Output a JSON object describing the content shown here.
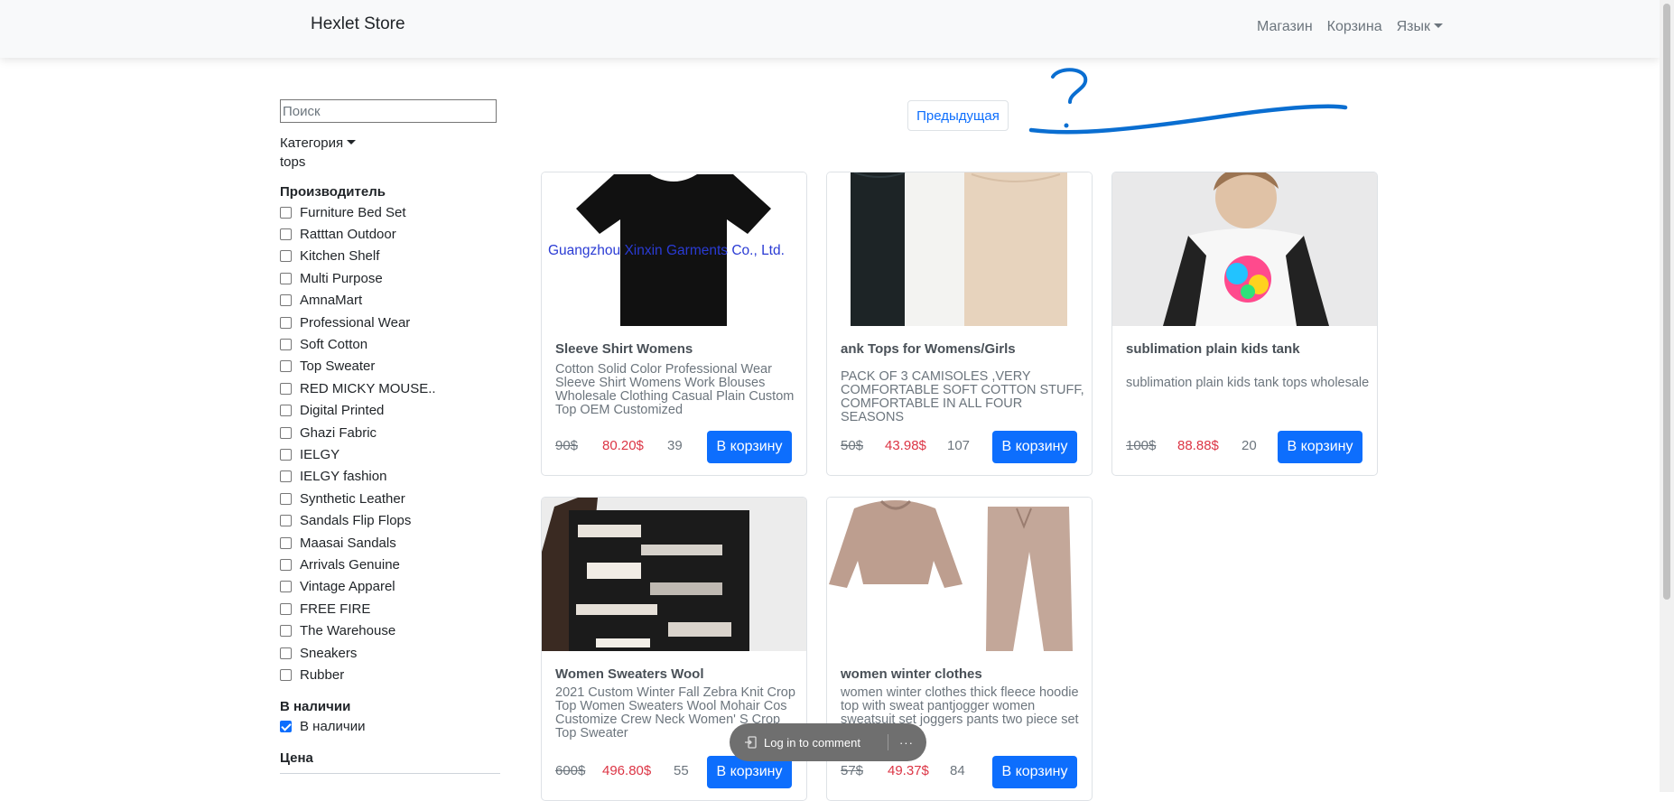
{
  "navbar": {
    "brand": "Hexlet Store",
    "links": [
      "Магазин",
      "Корзина"
    ],
    "language": "Язык"
  },
  "sidebar": {
    "search_placeholder": "Поиск",
    "category_label": "Категория",
    "category_value": "tops",
    "manufacturer_title": "Производитель",
    "manufacturers": [
      "Furniture Bed Set",
      "Ratttan Outdoor",
      "Kitchen Shelf",
      "Multi Purpose",
      "AmnaMart",
      "Professional Wear",
      "Soft Cotton",
      "Top Sweater",
      "RED MICKY MOUSE..",
      "Digital Printed",
      "Ghazi Fabric",
      "IELGY",
      "IELGY fashion",
      "Synthetic Leather",
      "Sandals Flip Flops",
      "Maasai Sandals",
      "Arrivals Genuine",
      "Vintage Apparel",
      "FREE FIRE",
      "The Warehouse",
      "Sneakers",
      "Rubber"
    ],
    "stock_title": "В наличии",
    "stock_option": "В наличии",
    "price_title": "Цена"
  },
  "pagination": {
    "prev": "Предыдущая"
  },
  "products": [
    {
      "title": "Sleeve Shirt Womens",
      "description": "Cotton Solid Color Professional Wear Sleeve Shirt Womens Work Blouses Wholesale Clothing Casual Plain Custom Top OEM Customized",
      "old_price": "90$",
      "price": "80.20$",
      "qty": "39",
      "button": "В корзину",
      "watermark": "Guangzhou Xinxin Garments Co., Ltd."
    },
    {
      "title": "ank Tops for Womens/Girls",
      "description": "PACK OF 3 CAMISOLES ,VERY COMFORTABLE SOFT COTTON STUFF, COMFORTABLE IN ALL FOUR SEASONS",
      "old_price": "50$",
      "price": "43.98$",
      "qty": "107",
      "button": "В корзину"
    },
    {
      "title": "sublimation plain kids tank",
      "description": "sublimation plain kids tank tops wholesale",
      "old_price": "100$",
      "price": "88.88$",
      "qty": "20",
      "button": "В корзину"
    },
    {
      "title": "Women Sweaters Wool",
      "description": "2021 Custom Winter Fall Zebra Knit Crop Top Women Sweaters Wool Mohair Cos Customize Crew Neck Women' S Crop Top Sweater",
      "old_price": "600$",
      "price": "496.80$",
      "qty": "55",
      "button": "В корзину"
    },
    {
      "title": "women winter clothes",
      "description": "women winter clothes thick fleece hoodie top with sweat pantjogger women sweatsuit set joggers pants two piece set",
      "old_price": "57$",
      "price": "49.37$",
      "qty": "84",
      "button": "В корзину"
    }
  ],
  "comment_bar": {
    "label": "Log in to comment",
    "more": "···"
  },
  "colors": {
    "primary": "#0d6efd",
    "price_red": "#dc3545",
    "navbar_bg": "#f8f9fa"
  }
}
